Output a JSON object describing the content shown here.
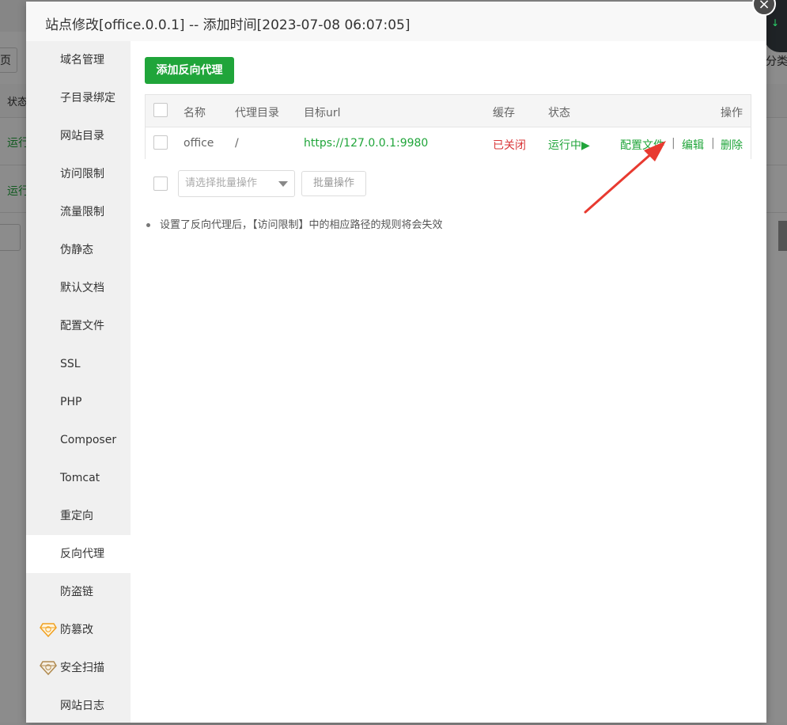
{
  "background": {
    "left_labels": [
      "页",
      "状态",
      "运行",
      "运行"
    ],
    "right_label": "分类"
  },
  "modal": {
    "title": "站点修改[office.0.0.1] -- 添加时间[2023-07-08 06:07:05]",
    "close_symbol": "×"
  },
  "sidebar": {
    "items": [
      {
        "label": "域名管理"
      },
      {
        "label": "子目录绑定"
      },
      {
        "label": "网站目录"
      },
      {
        "label": "访问限制"
      },
      {
        "label": "流量限制"
      },
      {
        "label": "伪静态"
      },
      {
        "label": "默认文档"
      },
      {
        "label": "配置文件"
      },
      {
        "label": "SSL"
      },
      {
        "label": "PHP"
      },
      {
        "label": "Composer"
      },
      {
        "label": "Tomcat"
      },
      {
        "label": "重定向"
      },
      {
        "label": "反向代理",
        "active": true
      },
      {
        "label": "防盗链"
      },
      {
        "label": "防篡改",
        "icon": "diamond-badge-icon",
        "icon_color": "#f0a020"
      },
      {
        "label": "安全扫描",
        "icon": "diamond-badge-icon",
        "icon_color": "#b08a50"
      },
      {
        "label": "网站日志"
      }
    ]
  },
  "content": {
    "add_button": "添加反向代理",
    "table": {
      "headers": {
        "name": "名称",
        "dir": "代理目录",
        "url": "目标url",
        "cache": "缓存",
        "status": "状态",
        "ops": "操作"
      },
      "rows": [
        {
          "name": "office",
          "dir": "/",
          "url": "https://127.0.0.1:9980",
          "cache": "已关闭",
          "status": "运行中▶",
          "op_config": "配置文件",
          "op_edit": "编辑",
          "op_delete": "删除",
          "separator": "|"
        }
      ]
    },
    "batch": {
      "placeholder": "请选择批量操作",
      "button": "批量操作"
    },
    "note": "设置了反向代理后，【访问限制】中的相应路径的规则将会失效"
  },
  "colors": {
    "primary": "#20a53a",
    "danger": "#d9383a",
    "annotation_arrow": "#e83a30"
  }
}
